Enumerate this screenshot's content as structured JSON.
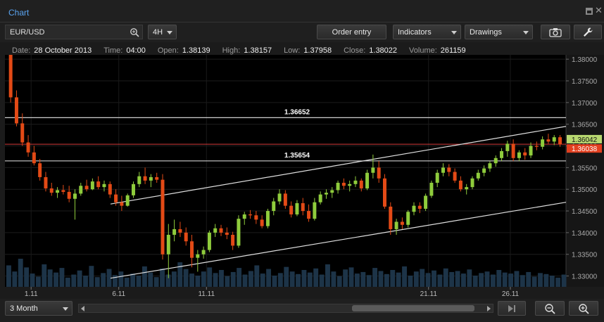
{
  "window": {
    "title": "Chart"
  },
  "toolbar": {
    "symbol": "EUR/USD",
    "timeframe": "4H",
    "order_entry_label": "Order entry",
    "indicators_label": "Indicators",
    "drawings_label": "Drawings"
  },
  "info": {
    "date_label": "Date:",
    "date": "28 October 2013",
    "time_label": "Time:",
    "time": "04:00",
    "open_label": "Open:",
    "open": "1.38139",
    "high_label": "High:",
    "high": "1.38157",
    "low_label": "Low:",
    "low": "1.37958",
    "close_label": "Close:",
    "close": "1.38022",
    "volume_label": "Volume:",
    "volume": "261159"
  },
  "bottom": {
    "range": "3 Month"
  },
  "colors": {
    "up": "#8fcc3c",
    "down": "#e34a16",
    "volume": "#1d3448",
    "price_line": "#d43a3a",
    "bid_badge": "#b8d870",
    "ask_badge": "#e23f1f",
    "title": "#5aa4f0"
  },
  "chart_data": {
    "type": "candlestick",
    "y_ticks": [
      "1.38000",
      "1.37500",
      "1.37000",
      "1.36500",
      "1.36000",
      "1.35500",
      "1.35000",
      "1.34500",
      "1.34000",
      "1.33500",
      "1.33000"
    ],
    "x_ticks": [
      "1.11",
      "6.11",
      "11.11",
      "21.11",
      "26.11"
    ],
    "ylim": [
      1.3275,
      1.381
    ],
    "horizontal_lines": [
      {
        "value": 1.36652,
        "label": "1.36652"
      },
      {
        "value": 1.35654,
        "label": "1.35654"
      }
    ],
    "current_price_line": 1.3604,
    "price_badges": [
      {
        "value": 1.36042,
        "label": "1.36042",
        "kind": "bid"
      },
      {
        "value": 1.36038,
        "label": "1.36038",
        "kind": "ask"
      }
    ],
    "channel": [
      {
        "from": [
          0,
          1.3466
        ],
        "to": [
          1,
          1.3645
        ]
      },
      {
        "from": [
          0,
          1.3295
        ],
        "to": [
          1,
          1.347
        ]
      }
    ],
    "candles": [
      [
        1.3813,
        1.3816,
        1.37,
        1.3712
      ],
      [
        1.3712,
        1.3728,
        1.3645,
        1.3652
      ],
      [
        1.3652,
        1.3675,
        1.36,
        1.3608
      ],
      [
        1.3608,
        1.3625,
        1.3575,
        1.3585
      ],
      [
        1.3585,
        1.36,
        1.3555,
        1.356
      ],
      [
        1.356,
        1.357,
        1.352,
        1.3528
      ],
      [
        1.3528,
        1.354,
        1.3495,
        1.3502
      ],
      [
        1.3502,
        1.3515,
        1.3485,
        1.3492
      ],
      [
        1.3492,
        1.3505,
        1.348,
        1.3498
      ],
      [
        1.3498,
        1.351,
        1.3488,
        1.3494
      ],
      [
        1.3494,
        1.3508,
        1.347,
        1.3478
      ],
      [
        1.3478,
        1.35,
        1.343,
        1.349
      ],
      [
        1.349,
        1.3515,
        1.3485,
        1.3508
      ],
      [
        1.3508,
        1.3522,
        1.3495,
        1.35
      ],
      [
        1.35,
        1.3525,
        1.3498,
        1.3518
      ],
      [
        1.3518,
        1.353,
        1.35,
        1.3505
      ],
      [
        1.3505,
        1.352,
        1.3495,
        1.3512
      ],
      [
        1.3512,
        1.3518,
        1.348,
        1.3488
      ],
      [
        1.3488,
        1.35,
        1.3462,
        1.347
      ],
      [
        1.347,
        1.3485,
        1.345,
        1.3462
      ],
      [
        1.3462,
        1.349,
        1.346,
        1.3486
      ],
      [
        1.3486,
        1.3518,
        1.348,
        1.3512
      ],
      [
        1.3512,
        1.354,
        1.3505,
        1.353
      ],
      [
        1.353,
        1.355,
        1.3512,
        1.352
      ],
      [
        1.352,
        1.3535,
        1.3505,
        1.3528
      ],
      [
        1.3528,
        1.3538,
        1.3515,
        1.3522
      ],
      [
        1.3522,
        1.3535,
        1.3338,
        1.335
      ],
      [
        1.335,
        1.342,
        1.3295,
        1.3395
      ],
      [
        1.3395,
        1.343,
        1.338,
        1.3408
      ],
      [
        1.3408,
        1.3425,
        1.339,
        1.34
      ],
      [
        1.34,
        1.3412,
        1.337,
        1.338
      ],
      [
        1.338,
        1.3395,
        1.332,
        1.3342
      ],
      [
        1.3342,
        1.336,
        1.331,
        1.335
      ],
      [
        1.335,
        1.3368,
        1.334,
        1.336
      ],
      [
        1.336,
        1.3405,
        1.3355,
        1.34
      ],
      [
        1.34,
        1.342,
        1.339,
        1.341
      ],
      [
        1.341,
        1.3418,
        1.3392,
        1.34
      ],
      [
        1.34,
        1.3412,
        1.3385,
        1.3395
      ],
      [
        1.3395,
        1.3402,
        1.336,
        1.337
      ],
      [
        1.337,
        1.344,
        1.3365,
        1.3432
      ],
      [
        1.3432,
        1.3448,
        1.3418,
        1.3442
      ],
      [
        1.3442,
        1.3452,
        1.3432,
        1.344
      ],
      [
        1.344,
        1.345,
        1.342,
        1.343
      ],
      [
        1.343,
        1.344,
        1.341,
        1.3415
      ],
      [
        1.3415,
        1.3455,
        1.341,
        1.345
      ],
      [
        1.345,
        1.348,
        1.344,
        1.3472
      ],
      [
        1.3472,
        1.35,
        1.3465,
        1.349
      ],
      [
        1.349,
        1.3498,
        1.3455,
        1.3462
      ],
      [
        1.3462,
        1.3472,
        1.3435,
        1.3442
      ],
      [
        1.3442,
        1.3475,
        1.3438,
        1.3468
      ],
      [
        1.3468,
        1.348,
        1.344,
        1.345
      ],
      [
        1.345,
        1.3465,
        1.3425,
        1.3432
      ],
      [
        1.3432,
        1.348,
        1.3428,
        1.347
      ],
      [
        1.347,
        1.3495,
        1.3465,
        1.3488
      ],
      [
        1.3488,
        1.35,
        1.3478,
        1.3492
      ],
      [
        1.3492,
        1.3505,
        1.348,
        1.3498
      ],
      [
        1.3498,
        1.352,
        1.349,
        1.3515
      ],
      [
        1.3515,
        1.3525,
        1.35,
        1.3508
      ],
      [
        1.3508,
        1.352,
        1.3495,
        1.3512
      ],
      [
        1.3512,
        1.353,
        1.3505,
        1.352
      ],
      [
        1.352,
        1.3525,
        1.3495,
        1.3502
      ],
      [
        1.3502,
        1.3545,
        1.3498,
        1.3538
      ],
      [
        1.3538,
        1.358,
        1.3525,
        1.355
      ],
      [
        1.355,
        1.3565,
        1.3515,
        1.3525
      ],
      [
        1.3525,
        1.3535,
        1.3455,
        1.346
      ],
      [
        1.346,
        1.347,
        1.3395,
        1.3408
      ],
      [
        1.3408,
        1.3432,
        1.3395,
        1.3425
      ],
      [
        1.3425,
        1.3435,
        1.3408,
        1.3418
      ],
      [
        1.3418,
        1.3452,
        1.3412,
        1.3448
      ],
      [
        1.3448,
        1.347,
        1.344,
        1.3462
      ],
      [
        1.3462,
        1.347,
        1.3445,
        1.3455
      ],
      [
        1.3455,
        1.349,
        1.345,
        1.3485
      ],
      [
        1.3485,
        1.352,
        1.348,
        1.3515
      ],
      [
        1.3515,
        1.3545,
        1.3505,
        1.3538
      ],
      [
        1.3538,
        1.356,
        1.353,
        1.355
      ],
      [
        1.355,
        1.3558,
        1.353,
        1.354
      ],
      [
        1.354,
        1.3548,
        1.3515,
        1.352
      ],
      [
        1.352,
        1.353,
        1.3495,
        1.35
      ],
      [
        1.35,
        1.3512,
        1.3488,
        1.3505
      ],
      [
        1.3505,
        1.353,
        1.35,
        1.3525
      ],
      [
        1.3525,
        1.3545,
        1.352,
        1.3538
      ],
      [
        1.3538,
        1.3555,
        1.353,
        1.3548
      ],
      [
        1.3548,
        1.3565,
        1.354,
        1.356
      ],
      [
        1.356,
        1.3578,
        1.3552,
        1.3572
      ],
      [
        1.3572,
        1.3595,
        1.3565,
        1.3588
      ],
      [
        1.3588,
        1.3612,
        1.3575,
        1.3605
      ],
      [
        1.3605,
        1.3615,
        1.3565,
        1.3572
      ],
      [
        1.3572,
        1.359,
        1.3565,
        1.3585
      ],
      [
        1.3585,
        1.3595,
        1.3568,
        1.3578
      ],
      [
        1.3578,
        1.3608,
        1.3572,
        1.36
      ],
      [
        1.36,
        1.361,
        1.359,
        1.3598
      ],
      [
        1.3598,
        1.3622,
        1.3592,
        1.3615
      ],
      [
        1.3615,
        1.3628,
        1.3605,
        1.361
      ],
      [
        1.361,
        1.3625,
        1.3602,
        1.362
      ],
      [
        1.362,
        1.3625,
        1.3598,
        1.3604
      ]
    ],
    "volume": [
      42,
      30,
      55,
      38,
      26,
      20,
      44,
      34,
      28,
      37,
      18,
      24,
      32,
      22,
      41,
      19,
      27,
      35,
      23,
      30,
      18,
      26,
      22,
      40,
      28,
      19,
      36,
      24,
      30,
      48,
      35,
      26,
      22,
      30,
      38,
      27,
      33,
      21,
      29,
      37,
      24,
      31,
      42,
      26,
      35,
      22,
      27,
      39,
      30,
      25,
      33,
      28,
      36,
      24,
      44,
      30,
      21,
      34,
      38,
      26,
      29,
      23,
      37,
      31,
      25,
      33,
      28,
      40,
      22,
      30,
      35,
      27,
      32,
      24,
      36,
      29,
      31,
      26,
      34,
      22,
      27,
      30,
      24,
      33,
      28,
      26,
      31,
      23,
      29,
      20,
      27,
      25,
      22,
      18,
      24
    ]
  }
}
